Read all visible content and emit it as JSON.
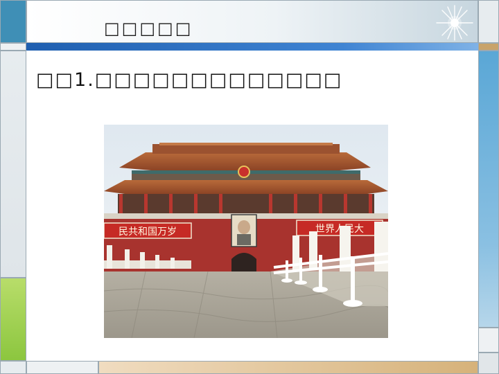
{
  "slide": {
    "title": "□□□□□",
    "prompt": "□□1.□□□□□□□□□□□□□"
  },
  "photo": {
    "banner_left": "民共和国万岁",
    "banner_right": "世界人民大"
  },
  "colors": {
    "accent_blue": "#2a6fc4",
    "frame_green": "#8cc63f",
    "gate_red": "#a8332e"
  }
}
